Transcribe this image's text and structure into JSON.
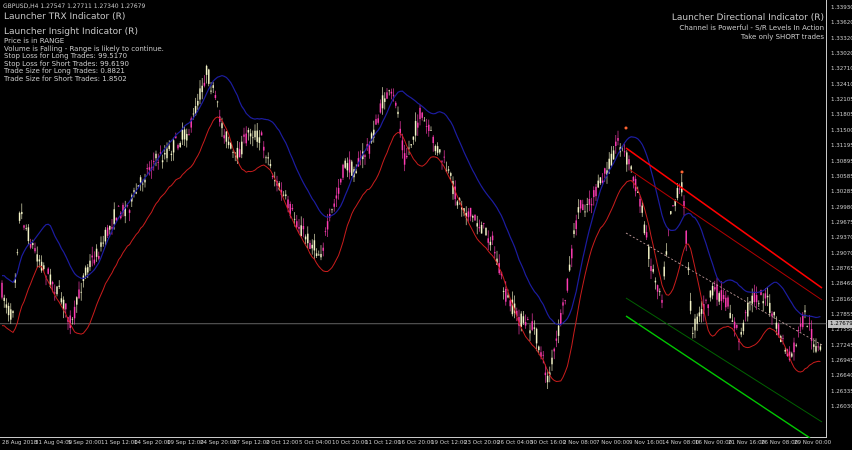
{
  "symbol_line": "GBPUSD,H4  1.27547 1.27711 1.27340 1.27679",
  "trx_title": "Launcher TRX Indicator (R)",
  "insight": {
    "title": "Launcher Insight Indicator (R)",
    "lines": [
      "Price is in RANGE",
      "Volume is Falling - Range is likely to continue.",
      "Stop Loss for Long Trades: 99.5170",
      "Stop Loss for Short Trades: 99.6190",
      "Trade Size for Long Trades: 0.8821",
      "Trade Size for Short Trades: 1.8502"
    ]
  },
  "directional": {
    "title": "Launcher Directional Indicator (R)",
    "line1": "Channel is Powerful - S/R Levels In Action",
    "line2": "Take only SHORT trades"
  },
  "price_axis": {
    "labels": [
      "1.33930",
      "1.33620",
      "1.33320",
      "1.33020",
      "1.32710",
      "1.32410",
      "1.32105",
      "1.31805",
      "1.31500",
      "1.31195",
      "1.30895",
      "1.30585",
      "1.30285",
      "1.29980",
      "1.29675",
      "1.29370",
      "1.29070",
      "1.28765",
      "1.28460",
      "1.28160",
      "1.27855",
      "1.27550",
      "1.27245",
      "1.26945",
      "1.26640",
      "1.26335",
      "1.26030"
    ],
    "current_price": "1.27679",
    "current_price_value": 1.27679
  },
  "time_axis": {
    "labels": [
      "28 Aug 2018",
      "31 Aug 04:00",
      "5 Sep 20:00",
      "11 Sep 12:00",
      "14 Sep 20:00",
      "19 Sep 12:00",
      "24 Sep 20:00",
      "27 Sep 12:00",
      "2 Oct 12:00",
      "5 Oct 04:00",
      "10 Oct 20:00",
      "11 Oct 12:00",
      "16 Oct 20:00",
      "19 Oct 12:00",
      "23 Oct 20:00",
      "26 Oct 04:00",
      "30 Oct 16:00",
      "2 Nov 08:00",
      "7 Nov 00:00",
      "9 Nov 16:00",
      "14 Nov 08:00",
      "16 Nov 00:00",
      "21 Nov 16:00",
      "26 Nov 08:00",
      "29 Nov 00:00"
    ]
  },
  "colors": {
    "background": "#000000",
    "foreground": "#c8c8c8",
    "bull_candle": "#f5f5c8",
    "bear_candle": "#ff3cb4",
    "slow_ma": "#1c1ca0",
    "fast_ma": "#c81c1c",
    "resistance_line": "#ff0000",
    "resistance_inner": "#b40000",
    "support_line": "#00c800",
    "support_inner": "#006400",
    "mid_line": "#c8a0a0",
    "signal_dot": "#ff6432"
  }
}
